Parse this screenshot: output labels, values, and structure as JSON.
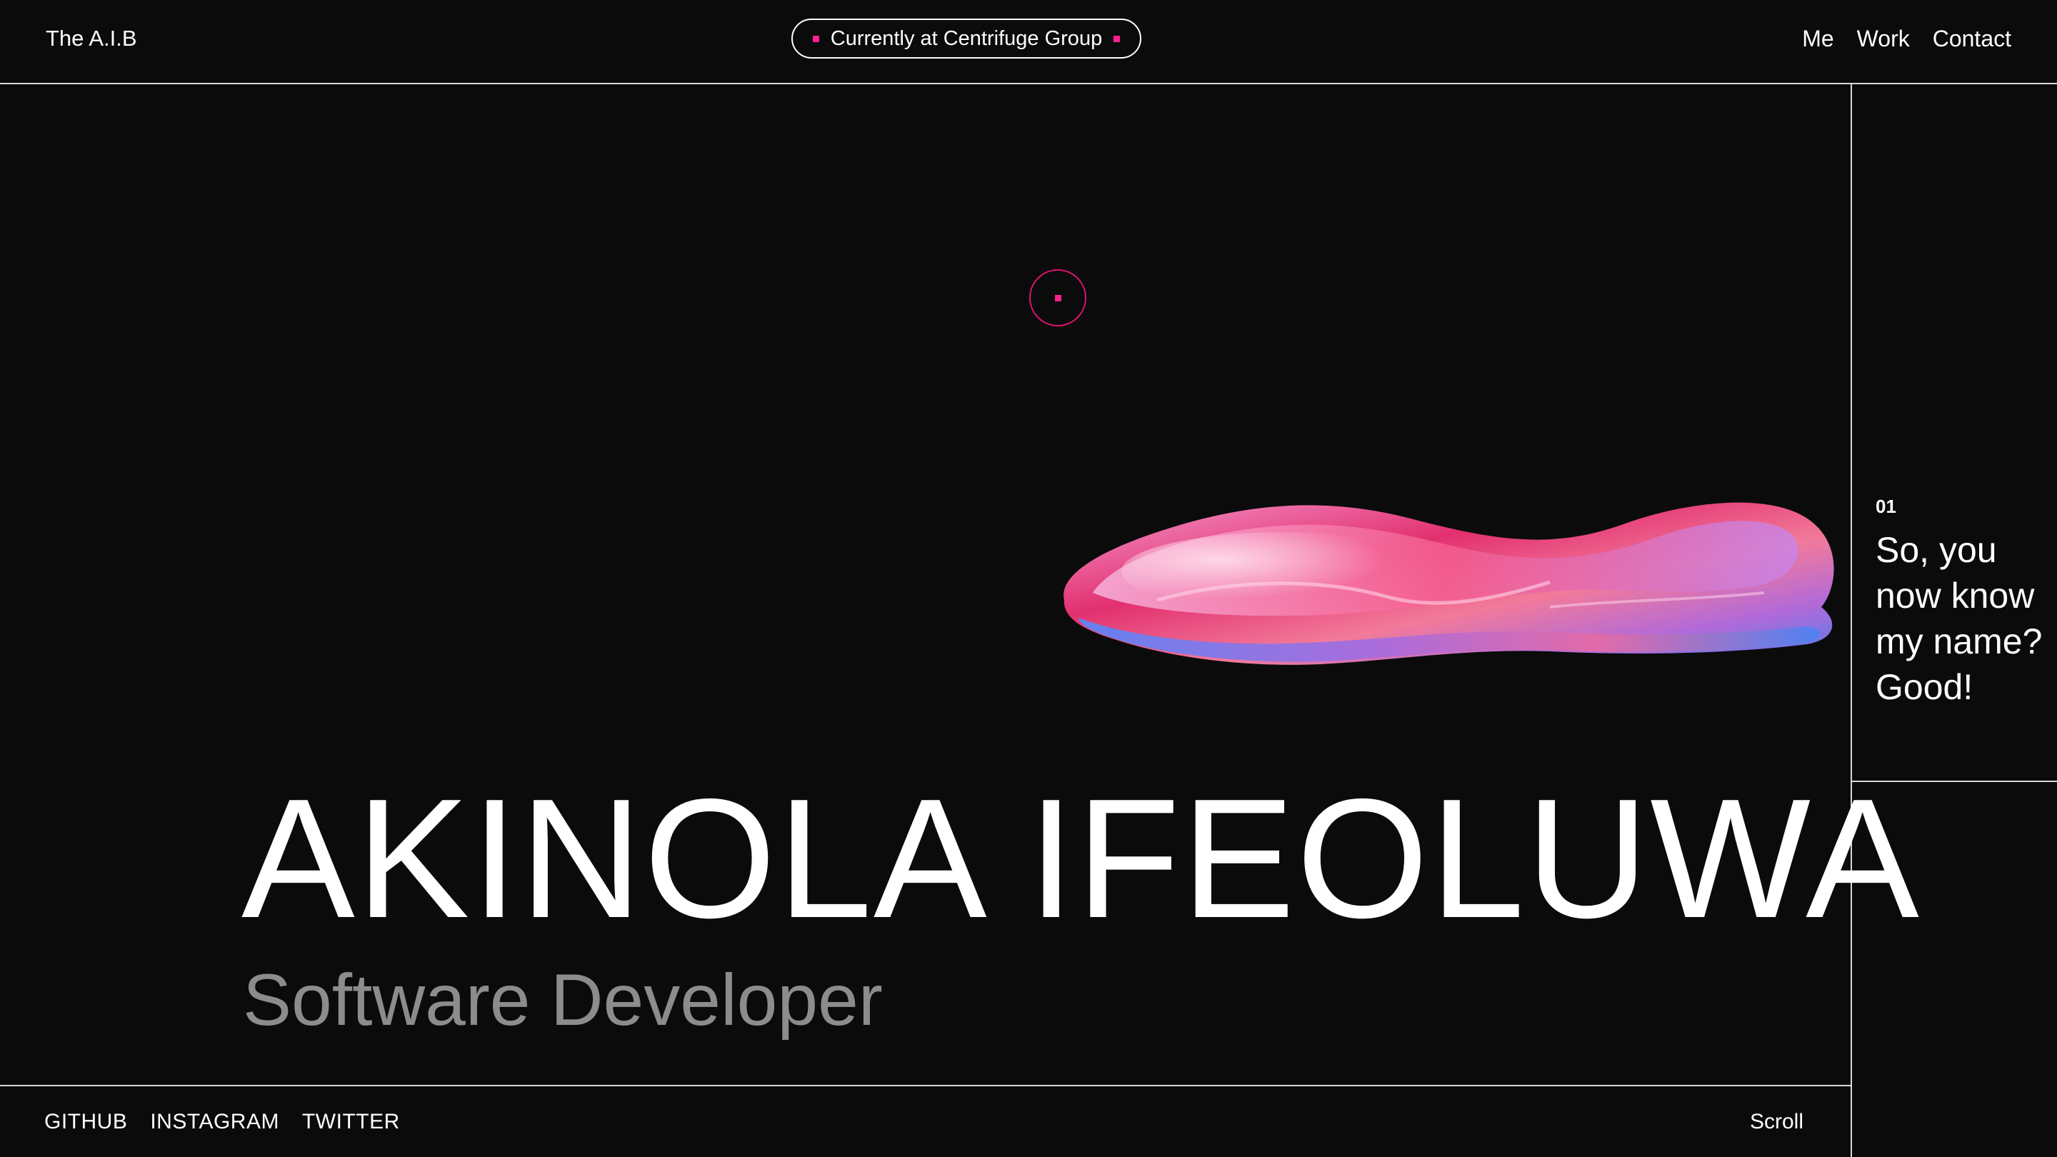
{
  "header": {
    "brand": "The A.I.B",
    "status": "Currently at Centrifuge Group",
    "nav": [
      "Me",
      "Work",
      "Contact"
    ]
  },
  "hero": {
    "name": "AKINOLA IFEOLUWA",
    "role": "Software Developer"
  },
  "side": {
    "index": "01",
    "text": "So, you now know my name? Good!"
  },
  "footer": {
    "socials": [
      "GITHUB",
      "INSTAGRAM",
      "TWITTER"
    ],
    "scroll": "Scroll"
  },
  "colors": {
    "background": "#0b0b0c",
    "accent": "#ff1f8e",
    "muted_text": "#8c8c8c",
    "line": "#d9d9d9"
  }
}
